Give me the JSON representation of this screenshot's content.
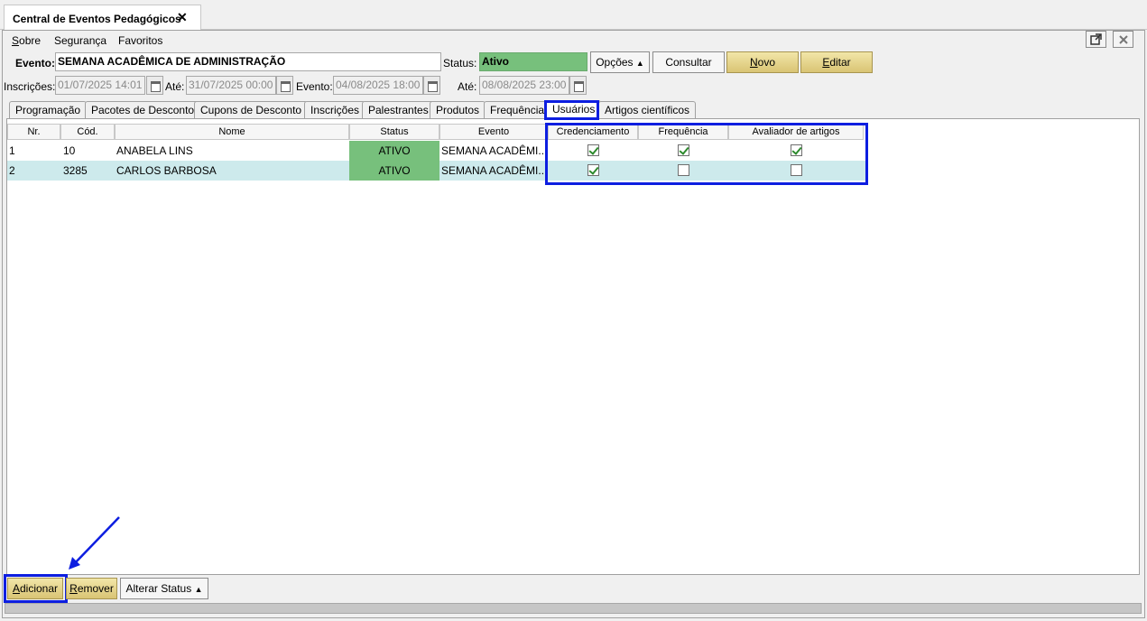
{
  "window": {
    "tab_title": "Central de Eventos Pedagógicos",
    "tab_close": "✕"
  },
  "menu": {
    "items": [
      "Sobre",
      "Segurança",
      "Favoritos"
    ]
  },
  "window_controls": {
    "popout_icon": "popout-icon",
    "close_icon": "close-icon"
  },
  "header": {
    "evento_label": "Evento:",
    "evento_value": "SEMANA ACADÊMICA DE ADMINISTRAÇÃO",
    "status_label": "Status:",
    "status_value": "Ativo",
    "opcoes_label": "Opções",
    "consultar_label": "Consultar",
    "novo_label": "Novo",
    "editar_label": "Editar",
    "inscricoes_label": "Inscrições:",
    "inscricoes_inicio": "01/07/2025 14:01",
    "ate1_label": "Até:",
    "inscricoes_fim": "31/07/2025 00:00",
    "evento2_label": "Evento:",
    "evento_inicio": "04/08/2025 18:00",
    "ate2_label": "Até:",
    "evento_fim": "08/08/2025 23:00"
  },
  "tabs": [
    {
      "label": "Programação"
    },
    {
      "label": "Pacotes de Desconto"
    },
    {
      "label": "Cupons de Desconto"
    },
    {
      "label": "Inscrições"
    },
    {
      "label": "Palestrantes"
    },
    {
      "label": "Produtos"
    },
    {
      "label": "Frequência"
    },
    {
      "label": "Usuários"
    },
    {
      "label": "Artigos científicos"
    }
  ],
  "table": {
    "columns": [
      "Nr.",
      "Cód.",
      "Nome",
      "Status",
      "Evento",
      "Credenciamento",
      "Frequência",
      "Avaliador de artigos"
    ],
    "rows": [
      {
        "nr": "1",
        "cod": "10",
        "nome": "ANABELA LINS",
        "status": "ATIVO",
        "evento": "SEMANA ACADÊMI...",
        "credenciamento": true,
        "frequencia": true,
        "avaliador": true
      },
      {
        "nr": "2",
        "cod": "3285",
        "nome": "CARLOS BARBOSA",
        "status": "ATIVO",
        "evento": "SEMANA ACADÊMI...",
        "credenciamento": true,
        "frequencia": false,
        "avaliador": false
      }
    ]
  },
  "footer": {
    "adicionar_label": "Adicionar",
    "remover_label": "Remover",
    "alterar_status_label": "Alterar Status"
  },
  "colors": {
    "accent_highlight": "#0d1ee0",
    "status_green": "#77c07c",
    "row_alt": "#cdeaec",
    "gold_button": "#e6d58f"
  }
}
